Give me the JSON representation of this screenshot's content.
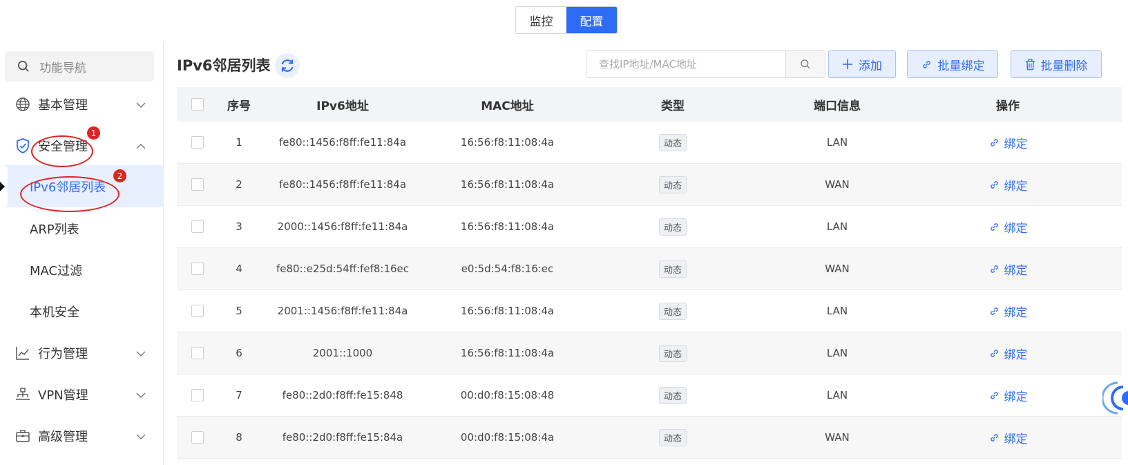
{
  "mode_toggle": {
    "monitor": "监控",
    "config": "配置"
  },
  "sidebar": {
    "search_placeholder": "功能导航",
    "items": [
      {
        "label": "基本管理",
        "icon": "globe-icon"
      },
      {
        "label": "安全管理",
        "icon": "shield-check-icon"
      },
      {
        "label": "行为管理",
        "icon": "line-chart-icon"
      },
      {
        "label": "VPN管理",
        "icon": "network-icon"
      },
      {
        "label": "高级管理",
        "icon": "briefcase-icon"
      }
    ],
    "sub_items": [
      {
        "label": "IPv6邻居列表"
      },
      {
        "label": "ARP列表"
      },
      {
        "label": "MAC过滤"
      },
      {
        "label": "本机安全"
      }
    ],
    "annotations": {
      "badge1": "1",
      "badge2": "2"
    }
  },
  "header": {
    "title": "IPv6邻居列表",
    "search_placeholder": "查找IP地址/MAC地址",
    "add_label": "添加",
    "batch_bind_label": "批量绑定",
    "batch_delete_label": "批量删除"
  },
  "table": {
    "columns": {
      "no": "序号",
      "ip": "IPv6地址",
      "mac": "MAC地址",
      "type": "类型",
      "port": "端口信息",
      "op": "操作"
    },
    "rows": [
      {
        "no": "1",
        "ip": "fe80::1456:f8ff:fe11:84a",
        "mac": "16:56:f8:11:08:4a",
        "type": "动态",
        "port": "LAN",
        "op": "绑定"
      },
      {
        "no": "2",
        "ip": "fe80::1456:f8ff:fe11:84a",
        "mac": "16:56:f8:11:08:4a",
        "type": "动态",
        "port": "WAN",
        "op": "绑定"
      },
      {
        "no": "3",
        "ip": "2000::1456:f8ff:fe11:84a",
        "mac": "16:56:f8:11:08:4a",
        "type": "动态",
        "port": "LAN",
        "op": "绑定"
      },
      {
        "no": "4",
        "ip": "fe80::e25d:54ff:fef8:16ec",
        "mac": "e0:5d:54:f8:16:ec",
        "type": "动态",
        "port": "WAN",
        "op": "绑定"
      },
      {
        "no": "5",
        "ip": "2001::1456:f8ff:fe11:84a",
        "mac": "16:56:f8:11:08:4a",
        "type": "动态",
        "port": "LAN",
        "op": "绑定"
      },
      {
        "no": "6",
        "ip": "2001::1000",
        "mac": "16:56:f8:11:08:4a",
        "type": "动态",
        "port": "LAN",
        "op": "绑定"
      },
      {
        "no": "7",
        "ip": "fe80::2d0:f8ff:fe15:848",
        "mac": "00:d0:f8:15:08:48",
        "type": "动态",
        "port": "LAN",
        "op": "绑定"
      },
      {
        "no": "8",
        "ip": "fe80::2d0:f8ff:fe15:84a",
        "mac": "00:d0:f8:15:08:4a",
        "type": "动态",
        "port": "WAN",
        "op": "绑定"
      }
    ]
  },
  "colors": {
    "accent": "#2f6cf6",
    "annotation": "#e02424"
  }
}
